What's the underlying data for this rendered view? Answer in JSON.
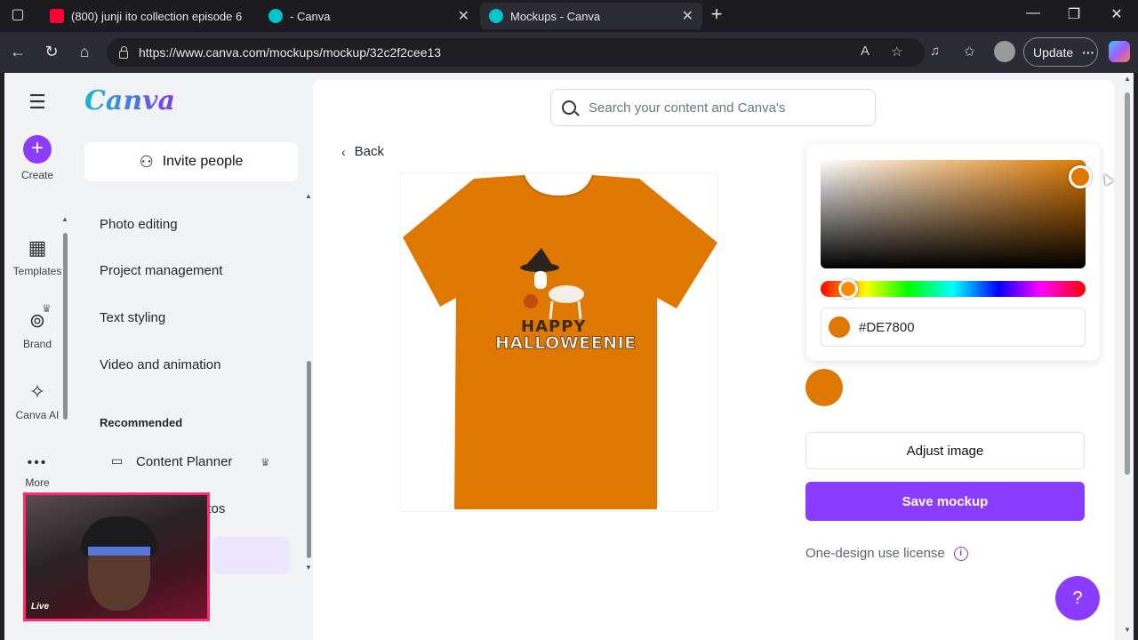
{
  "browser": {
    "tabs": [
      {
        "title": "(800) junji ito collection episode 6",
        "active": false,
        "favicon_color": "#ff0033"
      },
      {
        "title": "- Canva",
        "active": false,
        "favicon_color": "#00c4cc"
      },
      {
        "title": "Mockups - Canva",
        "active": true,
        "favicon_color": "#00c4cc"
      }
    ],
    "url": "https://www.canva.com/mockups/mockup/32c2f2cee13",
    "update_label": "Update"
  },
  "rail": {
    "items": [
      {
        "label": "Create",
        "icon": "plus-icon"
      },
      {
        "label": "Templates",
        "icon": "templates-icon"
      },
      {
        "label": "Brand",
        "icon": "brand-icon"
      },
      {
        "label": "Canva AI",
        "icon": "sparkle-icon"
      },
      {
        "label": "More",
        "icon": "more-icon"
      }
    ]
  },
  "panel": {
    "logo": "Canva",
    "invite_label": "Invite people",
    "nav_items": [
      "Photo editing",
      "Project management",
      "Text styling",
      "Video and animation"
    ],
    "recommended_heading": "Recommended",
    "recommended": [
      "Content Planner",
      "otos"
    ]
  },
  "webcam": {
    "live_label": "Live"
  },
  "main": {
    "search_placeholder": "Search your content and Canva's",
    "back_label": "Back",
    "design_text_1": "HAPPY",
    "design_text_2": "HALLOWEENIE",
    "hex_value": "#DE7800",
    "shirt_color": "#DE7800",
    "adjust_label": "Adjust image",
    "save_label": "Save mockup",
    "license_label": "One-design use license",
    "help_label": "?"
  }
}
